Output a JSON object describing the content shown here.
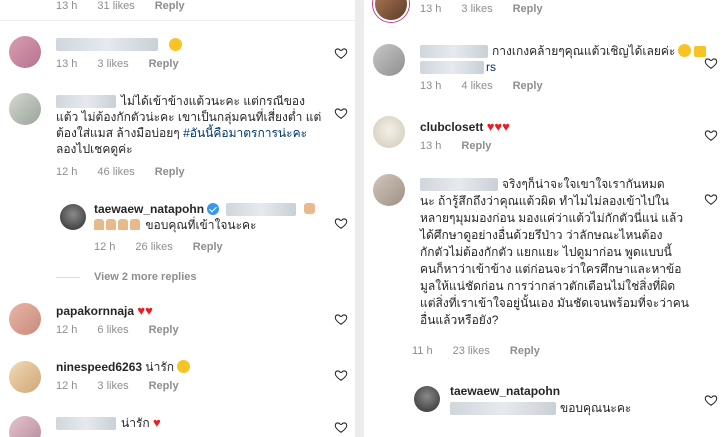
{
  "left": {
    "c0": {
      "time": "13 h",
      "likes": "31 likes",
      "reply": "Reply"
    },
    "c1": {
      "time": "13 h",
      "likes": "3 likes",
      "reply": "Reply"
    },
    "c2": {
      "line1": "ไม่ได้เข้าข้างแต้วนะคะ แต่กรณีของ",
      "line2": "แต้ว ไม่ต้องกักตัวน่ะคะ เขาเป็นกลุ่มคนที่เสี่ยงต่ำ แต่",
      "line3a": "ต้องใส่แมส ล้างมือบ่อยๆ ",
      "hashtag": "#อันนี้คือมาตรการน่ะคะ",
      "line4": "ลองไปเชคดูค่ะ",
      "time": "12 h",
      "likes": "46 likes",
      "reply": "Reply"
    },
    "c3": {
      "username": "taewaew_natapohn",
      "text": "ขอบคุณที่เข้าใจนะคะ",
      "time": "12 h",
      "likes": "26 likes",
      "reply": "Reply"
    },
    "view_more": "View 2 more replies",
    "c4": {
      "username": "papakornnaja",
      "hearts": "♥♥",
      "time": "12 h",
      "likes": "6 likes",
      "reply": "Reply"
    },
    "c5": {
      "username": "ninespeed6263",
      "text": "น่ารัก",
      "time": "12 h",
      "likes": "3 likes",
      "reply": "Reply"
    },
    "c6": {
      "text": "น่ารัก",
      "hearts": "♥"
    }
  },
  "right": {
    "c0": {
      "time": "13 h",
      "likes": "3 likes",
      "reply": "Reply"
    },
    "c1": {
      "text": "กางเกงคล้ายๆคุณแต้วเชิญได้เลยค่ะ",
      "suffix": "rs",
      "time": "13 h",
      "likes": "4 likes",
      "reply": "Reply"
    },
    "c2": {
      "username": "clubclosett",
      "hearts": "♥♥♥",
      "time": "13 h",
      "reply": "Reply"
    },
    "c3": {
      "l1": "จริงๆก็น่าจะใจเขาใจเรากันหมด",
      "l2": "นะ ถ้ารู้สึกถึงว่าคุณแต้วผิด ทำไมไม่ลองเข้าไปใน",
      "l3": "หลายๆมุมมองก่อน มองแค่ว่าแต้วไม่กักตัวนี่แน่ แล้ว",
      "l4": "ได้ศึกษาดูอย่างอื่นด้วยรึป่าว ว่าลักษณะไหนต้อง",
      "l5": "กักตัวไม่ต้องกักตัว แยกแยะ ไปดูมาก่อน พูดแบบนี้",
      "l6": "คนก็หาว่าเข้าข้าง แต่ก่อนจะว่าใครศึกษาและหาข้อ",
      "l7": "มูลให้แน่ชัดก่อน การว่ากล่าวตักเตือนไม่ใช่สิ่งที่ผิด",
      "l8": "แต่สิ่งที่เราเข้าใจอยู่นั้นเอง มันชัดเจนพร้อมที่จะว่าคน",
      "l9": "อื่นแล้วหรือยัง?",
      "time": "11 h",
      "likes": "23 likes",
      "reply": "Reply"
    },
    "c4": {
      "username": "taewaew_natapohn",
      "text": "ขอบคุณนะคะ"
    }
  },
  "colors": {
    "heart": "#ed1c24",
    "link": "#003569",
    "meta": "#8e8e8e",
    "verified": "#3897f0"
  }
}
